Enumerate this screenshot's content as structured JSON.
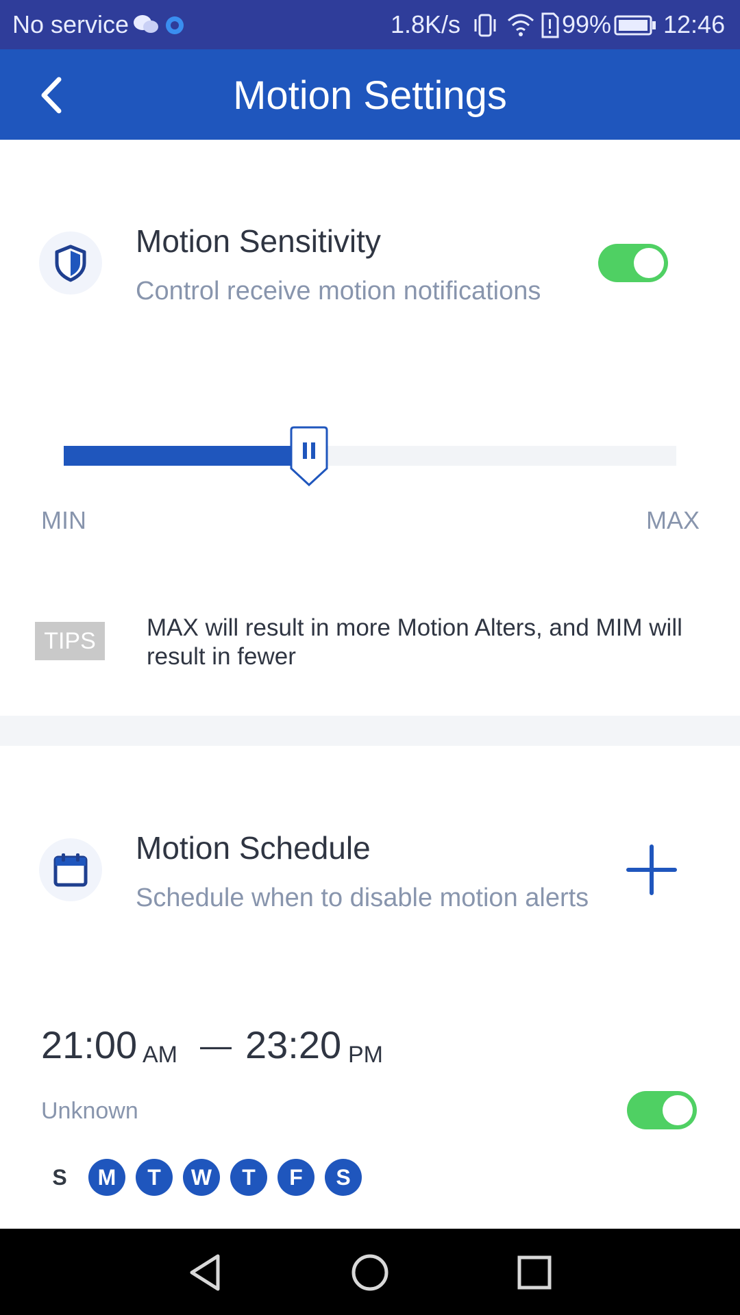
{
  "status_bar": {
    "carrier": "No service",
    "network_speed": "1.8K/s",
    "battery": "99%",
    "time": "12:46"
  },
  "header": {
    "title": "Motion Settings"
  },
  "sensitivity": {
    "title": "Motion Sensitivity",
    "subtitle": "Control receive motion notifications",
    "enabled": true,
    "level_fraction": 0.4,
    "min_label": "MIN",
    "max_label": "MAX",
    "tips_badge": "TIPS",
    "tips_text": "MAX will result in more Motion Alters, and MIM will result in fewer"
  },
  "schedule": {
    "title": "Motion Schedule",
    "subtitle": "Schedule when to disable motion alerts",
    "entry": {
      "start_time": "21:00",
      "start_ampm": "AM",
      "separator": "—",
      "end_time": "23:20",
      "end_ampm": "PM",
      "label": "Unknown",
      "enabled": true,
      "days": [
        {
          "letter": "S",
          "active": false
        },
        {
          "letter": "M",
          "active": true
        },
        {
          "letter": "T",
          "active": true
        },
        {
          "letter": "W",
          "active": true
        },
        {
          "letter": "T",
          "active": true
        },
        {
          "letter": "F",
          "active": true
        },
        {
          "letter": "S",
          "active": true
        }
      ]
    }
  },
  "colors": {
    "primary": "#1f56bd",
    "toggle_on": "#4fd063",
    "status_bar": "#2f3d9a"
  }
}
